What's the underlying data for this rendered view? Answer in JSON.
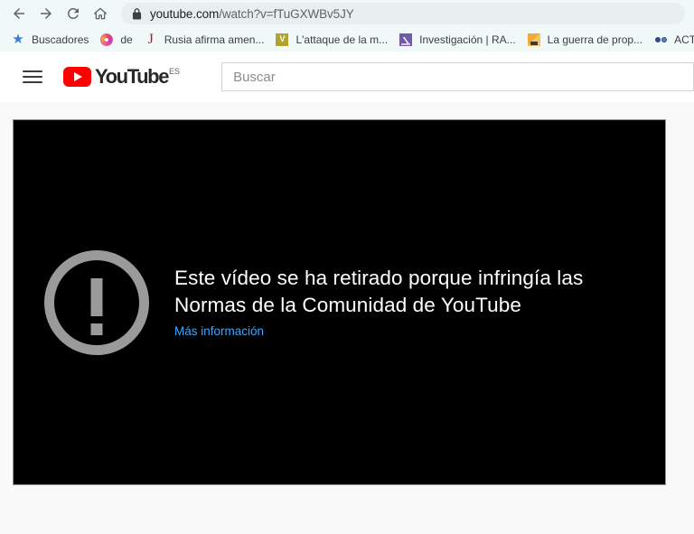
{
  "browser": {
    "nav": {
      "back_icon": "arrow-left-icon",
      "forward_icon": "arrow-right-icon",
      "reload_icon": "reload-icon",
      "home_icon": "home-icon"
    },
    "omnibox": {
      "lock_icon": "lock-icon",
      "url_host": "youtube.com",
      "url_path": "/watch?v=fTuGXWBv5JY",
      "full_url": "youtube.com/watch?v=fTuGXWBv5JY"
    },
    "bookmarks": [
      {
        "label": "Buscadores",
        "icon": "star-icon"
      },
      {
        "label": "de",
        "icon": "swirl-favicon"
      },
      {
        "label": "Rusia afirma amen...",
        "icon": "jstor-j-favicon"
      },
      {
        "label": "L'attaque de la m...",
        "icon": "olive-v-favicon"
      },
      {
        "label": "Investigación | RA...",
        "icon": "rand-purple-favicon"
      },
      {
        "label": "La guerra de prop...",
        "icon": "orange-square-favicon"
      },
      {
        "label": "ACT",
        "icon": "blue-glasses-favicon"
      }
    ]
  },
  "youtube": {
    "menu_icon": "hamburger-menu-icon",
    "logo": {
      "play_icon": "youtube-play-icon",
      "wordmark": "YouTube",
      "country_code": "ES"
    },
    "search": {
      "placeholder": "Buscar",
      "value": ""
    },
    "player": {
      "warning_icon": "exclamation-circle-icon",
      "error_message": "Este vídeo se ha retirado porque infringía las Normas de la Comunidad de YouTube",
      "more_info_link": "Más información",
      "background_color": "#000000",
      "link_color": "#3ea6ff",
      "icon_color": "#9a9a9a"
    }
  }
}
